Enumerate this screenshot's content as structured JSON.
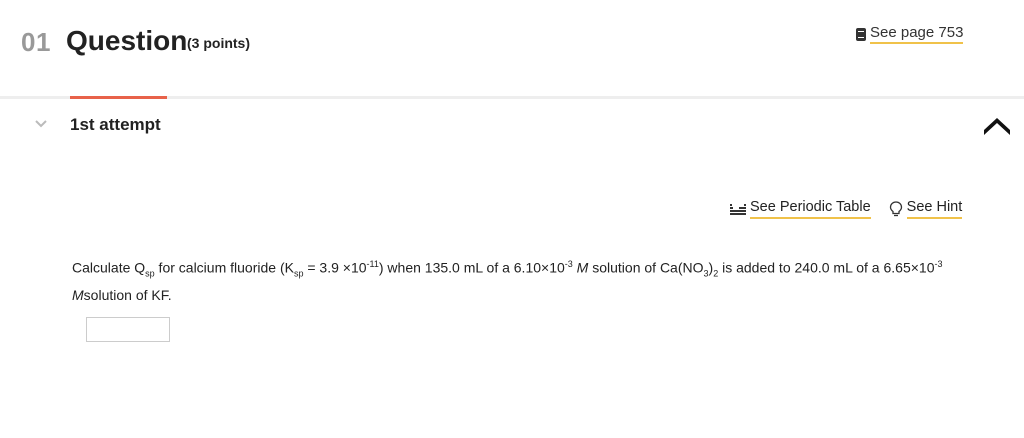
{
  "header": {
    "number": "01",
    "title": "Question",
    "points": "(3 points)",
    "see_page": "See page 753"
  },
  "attempt": {
    "label": "1st attempt"
  },
  "tools": {
    "periodic_table": "See Periodic Table",
    "hint": "See Hint"
  },
  "question": {
    "p1": "Calculate Q",
    "p1_sub": "sp",
    "p2": " for calcium fluoride (K",
    "p2_sub": "sp",
    "p3": " = 3.9 ×10",
    "p3_sup": "-11",
    "p4": ") when 135.0 mL of a 6.10×10",
    "p4_sup": "-3",
    "p5": " ",
    "p5_i": "M",
    "p6": " solution of Ca(NO",
    "p6_sub": "3",
    "p7": ")",
    "p7_sub": "2",
    "p8": " is added to 240.0 mL of a 6.65×10",
    "p8_sup": "-3",
    "p9": " ",
    "p9_i": "M",
    "p10": "solution of KF."
  },
  "answer": {
    "value": ""
  },
  "colors": {
    "accent_tab": "#e8624a",
    "link_underline": "#f0c24a",
    "question_number": "#999999"
  }
}
